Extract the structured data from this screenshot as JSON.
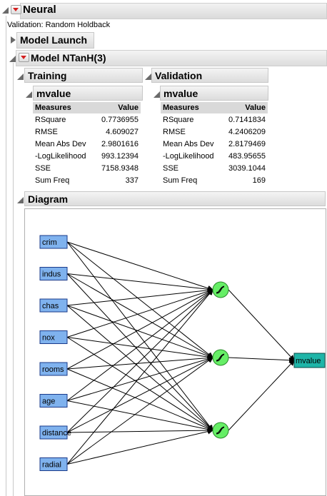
{
  "report": {
    "title": "Neural",
    "validation_note": "Validation: Random Holdback"
  },
  "model_launch": {
    "title": "Model Launch"
  },
  "model": {
    "title": "Model NTanH(3)"
  },
  "training": {
    "title": "Training",
    "response": "mvalue",
    "col_measures": "Measures",
    "col_value": "Value",
    "rows": [
      {
        "label": "RSquare",
        "value": "0.7736955"
      },
      {
        "label": "RMSE",
        "value": "4.609027"
      },
      {
        "label": "Mean Abs Dev",
        "value": "2.9801616"
      },
      {
        "label": "-LogLikelihood",
        "value": "993.12394"
      },
      {
        "label": "SSE",
        "value": "7158.9348"
      },
      {
        "label": "Sum Freq",
        "value": "337"
      }
    ]
  },
  "validation": {
    "title": "Validation",
    "response": "mvalue",
    "col_measures": "Measures",
    "col_value": "Value",
    "rows": [
      {
        "label": "RSquare",
        "value": "0.7141834"
      },
      {
        "label": "RMSE",
        "value": "4.2406209"
      },
      {
        "label": "Mean Abs Dev",
        "value": "2.8179469"
      },
      {
        "label": "-LogLikelihood",
        "value": "483.95655"
      },
      {
        "label": "SSE",
        "value": "3039.1044"
      },
      {
        "label": "Sum Freq",
        "value": "169"
      }
    ]
  },
  "diagram": {
    "title": "Diagram",
    "inputs": [
      "crim",
      "indus",
      "chas",
      "nox",
      "rooms",
      "age",
      "distance",
      "radial"
    ],
    "hidden_count": 3,
    "output": "mvalue",
    "colors": {
      "input_fill": "#7fb2ee",
      "hidden_fill": "#66ee66",
      "output_fill": "#1fb5a8"
    }
  }
}
